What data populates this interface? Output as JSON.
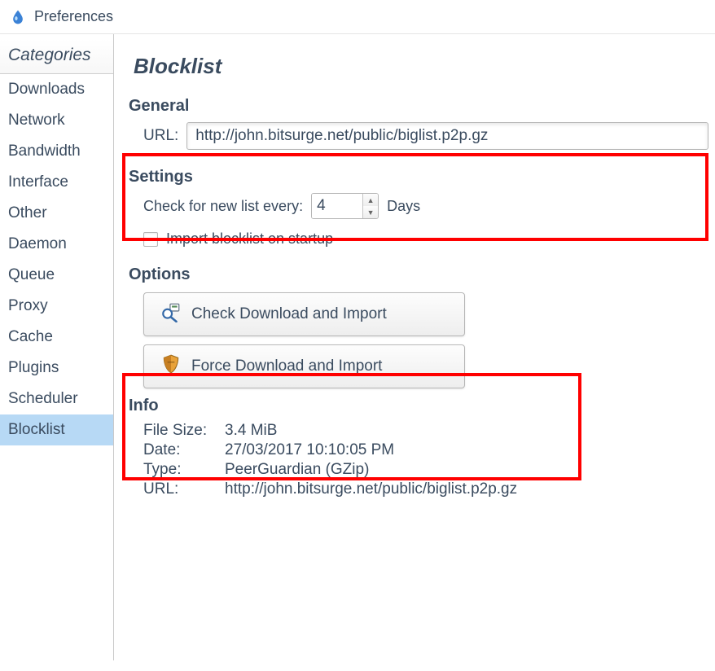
{
  "window": {
    "title": "Preferences"
  },
  "sidebar": {
    "header": "Categories",
    "items": [
      {
        "label": "Downloads"
      },
      {
        "label": "Network"
      },
      {
        "label": "Bandwidth"
      },
      {
        "label": "Interface"
      },
      {
        "label": "Other"
      },
      {
        "label": "Daemon"
      },
      {
        "label": "Queue"
      },
      {
        "label": "Proxy"
      },
      {
        "label": "Cache"
      },
      {
        "label": "Plugins"
      },
      {
        "label": "Scheduler"
      },
      {
        "label": "Blocklist"
      }
    ]
  },
  "page": {
    "title": "Blocklist",
    "general": {
      "title": "General",
      "urlLabel": "URL:",
      "urlValue": "http://john.bitsurge.net/public/biglist.p2p.gz"
    },
    "settings": {
      "title": "Settings",
      "checkEveryLabel": "Check for new list every:",
      "checkEveryValue": "4",
      "daysLabel": "Days",
      "importOnStartup": "Import blocklist on startup"
    },
    "options": {
      "title": "Options",
      "checkDownload": "Check Download and Import",
      "forceDownload": "Force Download and Import"
    },
    "info": {
      "title": "Info",
      "fileSizeLabel": "File Size:",
      "fileSizeValue": "3.4 MiB",
      "dateLabel": "Date:",
      "dateValue": "27/03/2017 10:10:05 PM",
      "typeLabel": "Type:",
      "typeValue": "PeerGuardian (GZip)",
      "urlLabel": "URL:",
      "urlValue": "http://john.bitsurge.net/public/biglist.p2p.gz"
    }
  }
}
